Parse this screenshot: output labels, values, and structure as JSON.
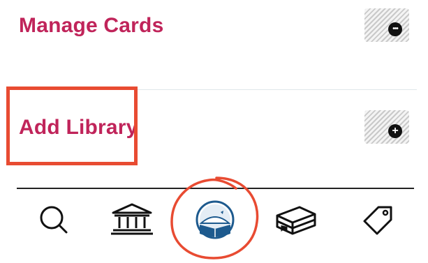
{
  "menu": {
    "manage_cards": {
      "label": "Manage Cards",
      "icon": "more-icon",
      "badge": "•••"
    },
    "add_library": {
      "label": "Add Library",
      "icon": "add-icon",
      "badge": "+"
    }
  },
  "tab_bar": {
    "tabs": [
      {
        "name": "search",
        "icon": "search-icon"
      },
      {
        "name": "library",
        "icon": "library-building-icon"
      },
      {
        "name": "reader",
        "icon": "reader-app-icon",
        "selected": true
      },
      {
        "name": "books",
        "icon": "books-stack-icon"
      },
      {
        "name": "tags",
        "icon": "tag-icon"
      }
    ]
  },
  "colors": {
    "accent": "#c0245a",
    "annotation": "#e84b32",
    "app_icon_blue": "#1d5a8e"
  }
}
